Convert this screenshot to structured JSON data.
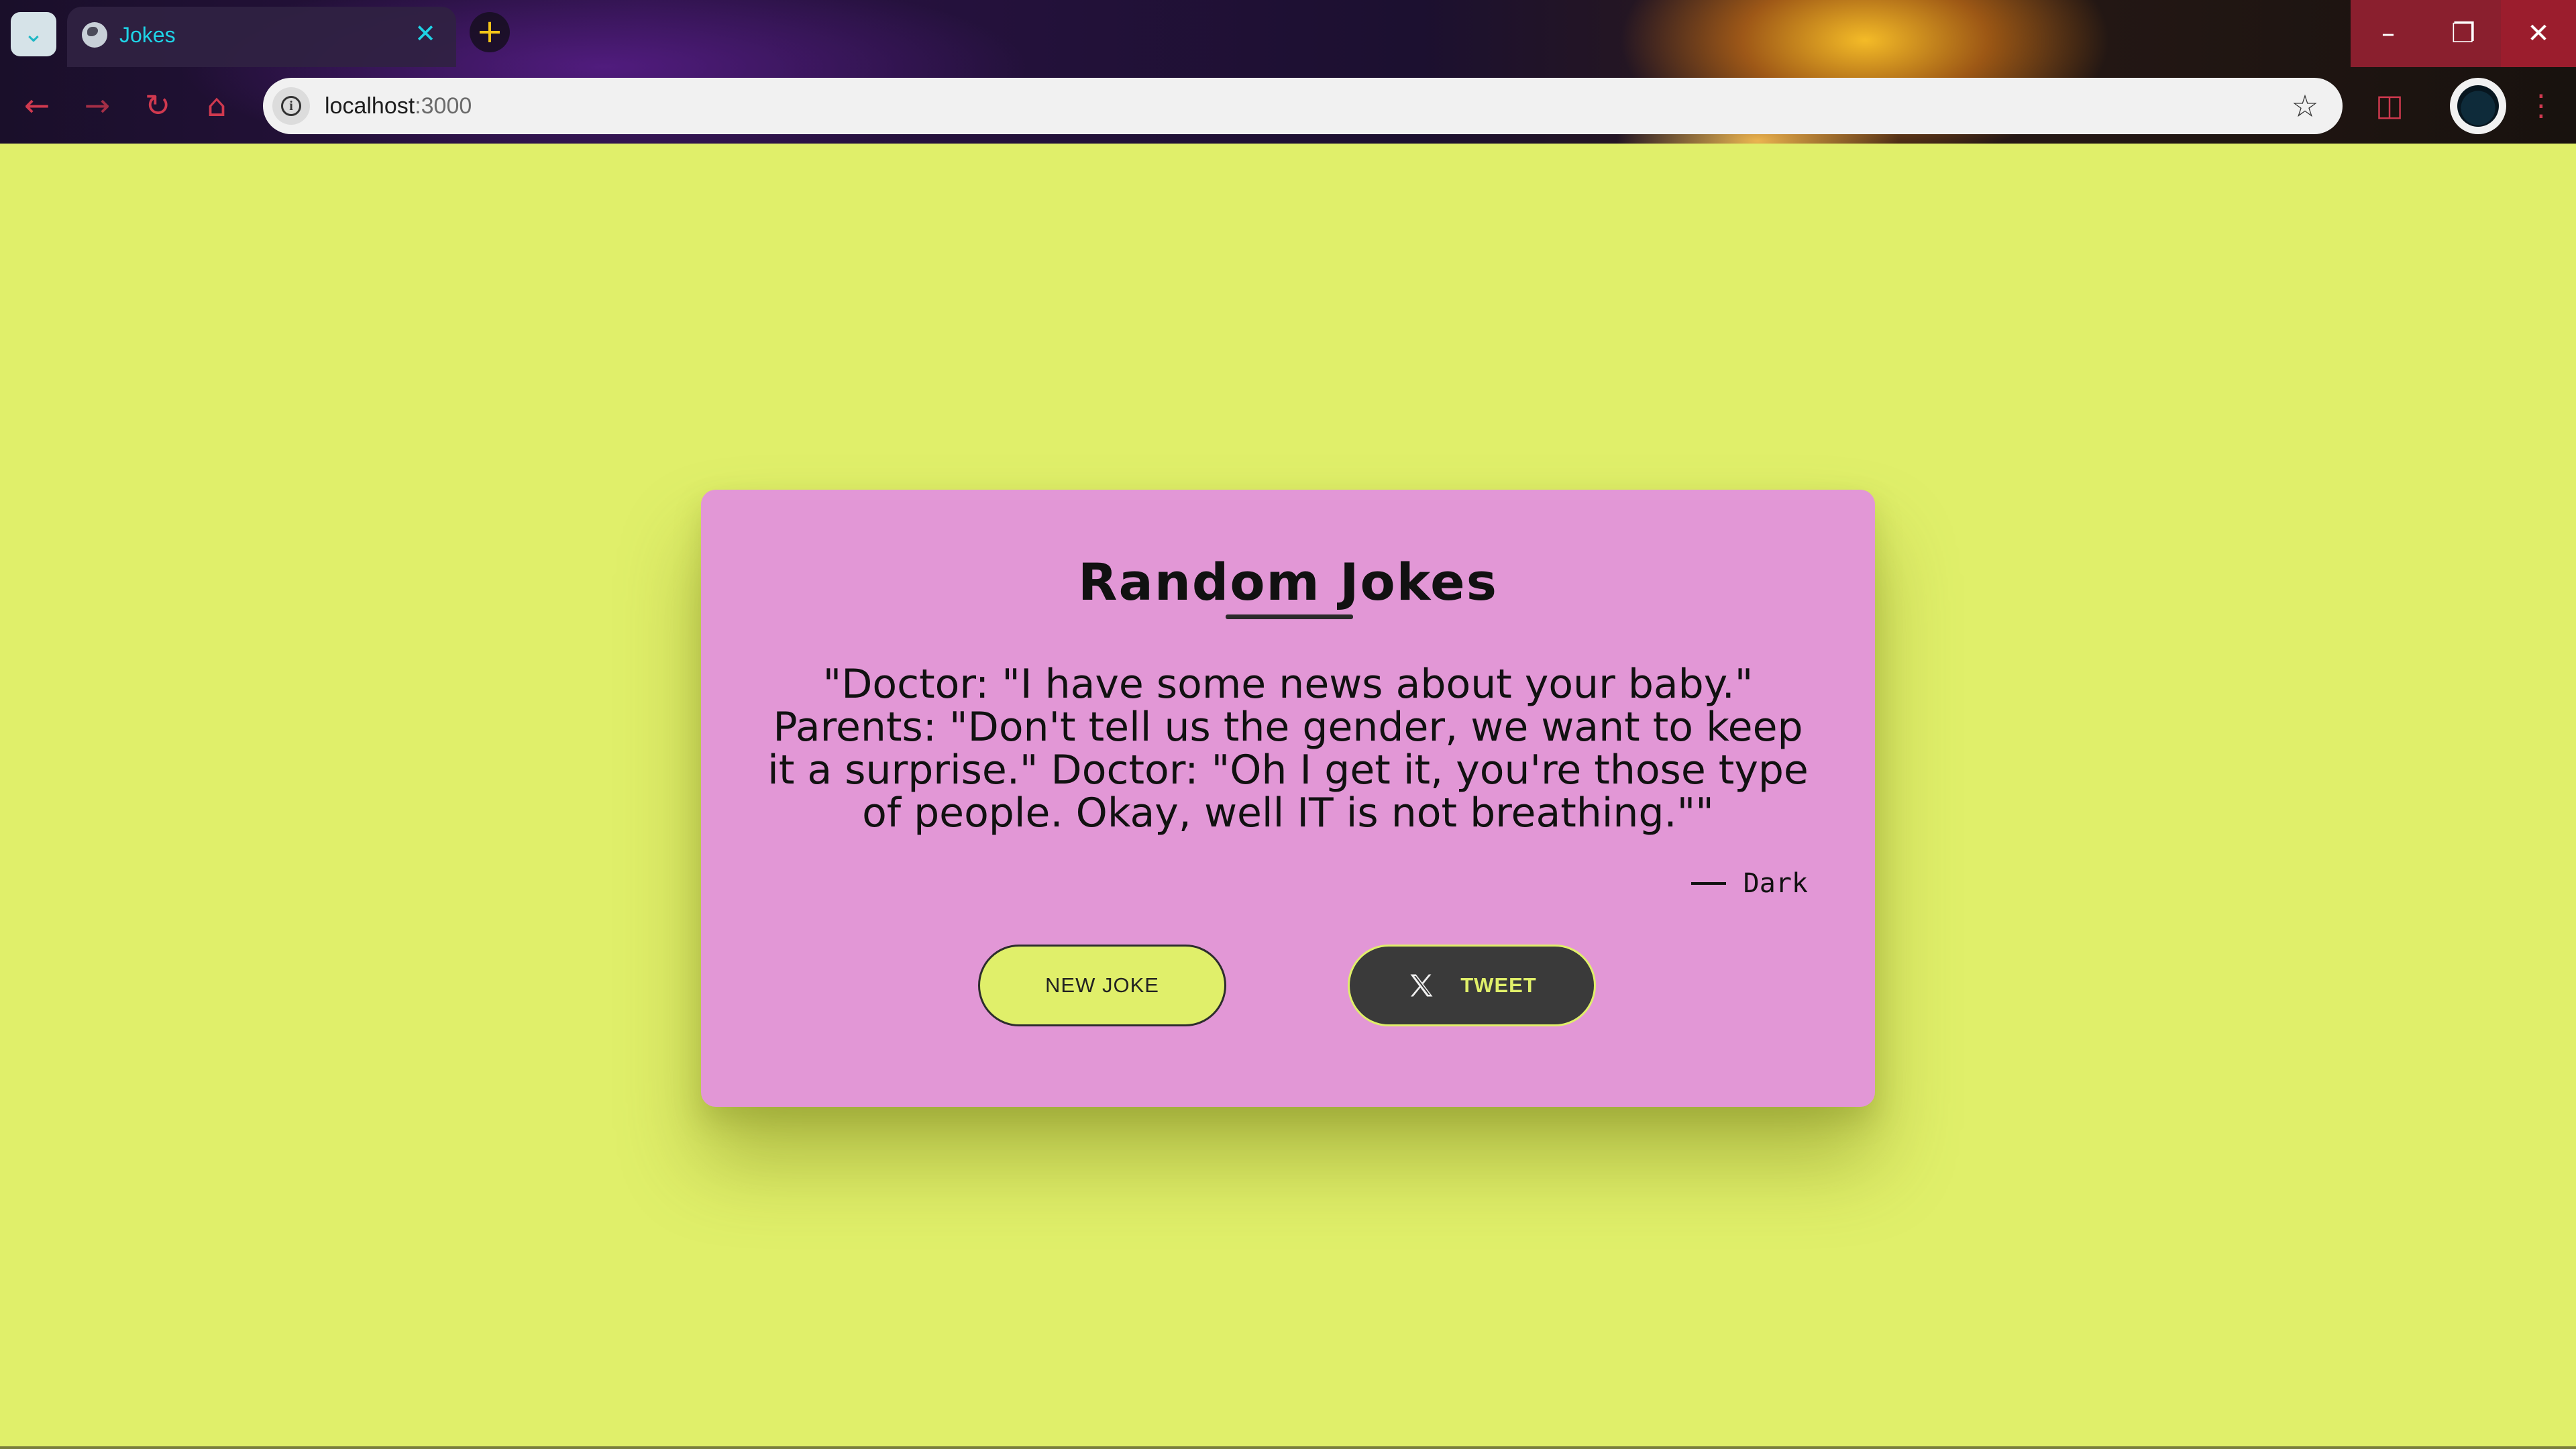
{
  "browser": {
    "tab": {
      "title": "Jokes"
    },
    "address_bar": {
      "host": "localhost",
      "port": ":3000"
    },
    "icons": {
      "tab_search": "chevron-down-icon",
      "favicon": "globe-icon",
      "tab_close": "close-icon",
      "new_tab": "plus-icon",
      "back": "back-arrow-icon",
      "forward": "forward-arrow-icon",
      "reload": "reload-icon",
      "home": "home-icon",
      "site_info": "info-icon",
      "bookmark": "star-icon",
      "extensions": "puzzle-icon",
      "menu": "kebab-menu-icon"
    },
    "colors": {
      "accent": "#1fd3e6",
      "toolbar_icons": "#d0394f",
      "window_controls": "#8a1f2e"
    }
  },
  "page": {
    "background": "#e0ef6a",
    "card": {
      "title": "Random Jokes",
      "joke": "\"Doctor: \"I have some news about your baby.\" Parents: \"Don't tell us the gender, we want to keep it a surprise.\" Doctor: \"Oh I get it, you're those type of people. Okay, well IT is not breathing.\"\"",
      "author": "Dark",
      "background": "#e297d6"
    },
    "buttons": {
      "new_joke": "NEW JOKE",
      "tweet": "TWEET"
    }
  }
}
